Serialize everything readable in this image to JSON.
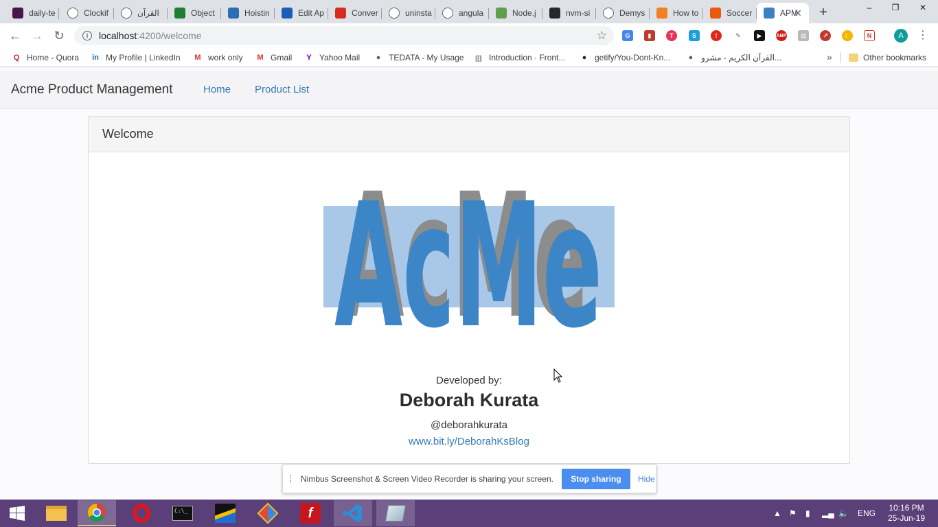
{
  "browser": {
    "tabs": [
      {
        "title": "daily-te",
        "icon": "slack-icon",
        "color": "#4a154b"
      },
      {
        "title": "Clockif",
        "icon": "clockify-icon",
        "color": "#ffffff"
      },
      {
        "title": "القرآن",
        "icon": "globe-icon",
        "color": "#ffffff"
      },
      {
        "title": "Object",
        "icon": "code-icon",
        "color": "#1e7e34"
      },
      {
        "title": "Hoistin",
        "icon": "bird-icon",
        "color": "#2d6db5"
      },
      {
        "title": "Edit Ap",
        "icon": "word-icon",
        "color": "#1a5fb4"
      },
      {
        "title": "Conver",
        "icon": "convert-icon",
        "color": "#d62d20"
      },
      {
        "title": "uninsta",
        "icon": "google-icon",
        "color": "#ffffff"
      },
      {
        "title": "angula",
        "icon": "google-icon",
        "color": "#ffffff"
      },
      {
        "title": "Node.j",
        "icon": "nodejs-icon",
        "color": "#5fa04e"
      },
      {
        "title": "nvm-si",
        "icon": "github-icon",
        "color": "#24292e"
      },
      {
        "title": "Demys",
        "icon": "diamond-icon",
        "color": "#ffffff"
      },
      {
        "title": "How to",
        "icon": "stackoverflow-icon",
        "color": "#f48024"
      },
      {
        "title": "Soccer",
        "icon": "soccer-icon",
        "color": "#e8590c"
      },
      {
        "title": "APM",
        "icon": "acme-icon",
        "color": "#3f7fc3"
      }
    ],
    "new_tab_symbol": "+",
    "url_host": "localhost",
    "url_path": ":4200/welcome",
    "bookmarks": [
      {
        "label": "Home - Quora",
        "icon": "quora-icon",
        "glyph": "Q",
        "color": "#b92b27"
      },
      {
        "label": "My Profile | LinkedIn",
        "icon": "linkedin-icon",
        "glyph": "in",
        "color": "#0a66c2"
      },
      {
        "label": "work only",
        "icon": "gmail-icon",
        "glyph": "M",
        "color": "#d93025"
      },
      {
        "label": "Gmail",
        "icon": "gmail-icon",
        "glyph": "M",
        "color": "#d93025"
      },
      {
        "label": "Yahoo Mail",
        "icon": "yahoo-icon",
        "glyph": "Y",
        "color": "#6001d2"
      },
      {
        "label": "TEDATA - My Usage",
        "icon": "globe-icon",
        "glyph": "●",
        "color": "#5f6368"
      },
      {
        "label": "Introduction · Front...",
        "icon": "book-icon",
        "glyph": "▥",
        "color": "#5f6368"
      },
      {
        "label": "getify/You-Dont-Kn...",
        "icon": "github-icon",
        "glyph": "●",
        "color": "#24292e"
      },
      {
        "label": "القرآن الكريم - مشرو...",
        "icon": "globe-icon",
        "glyph": "●",
        "color": "#5f6368"
      }
    ],
    "bookmarks_more": "»",
    "other_bookmarks": "Other bookmarks",
    "profile_initial": "A"
  },
  "app": {
    "brand": "Acme Product Management",
    "nav": {
      "home": "Home",
      "products": "Product List"
    },
    "card_title": "Welcome",
    "logo_text": "AcMe",
    "developed_by": "Developed by:",
    "author": "Deborah Kurata",
    "handle": "@deborahkurata",
    "blog": "www.bit.ly/DeborahKsBlog"
  },
  "sharing": {
    "message": "Nimbus Screenshot & Screen Video Recorder is sharing your screen.",
    "stop": "Stop sharing",
    "hide": "Hide"
  },
  "taskbar": {
    "language": "ENG",
    "time": "10:16 PM",
    "date": "25-Jun-19"
  },
  "colors": {
    "link": "#337ab7",
    "logo_blue": "#3c85c6",
    "logo_shadow": "#8c8c8c",
    "logo_rect": "#a9c7e6",
    "taskbar": "#5b3f78",
    "stop_button": "#4c8ef0"
  }
}
